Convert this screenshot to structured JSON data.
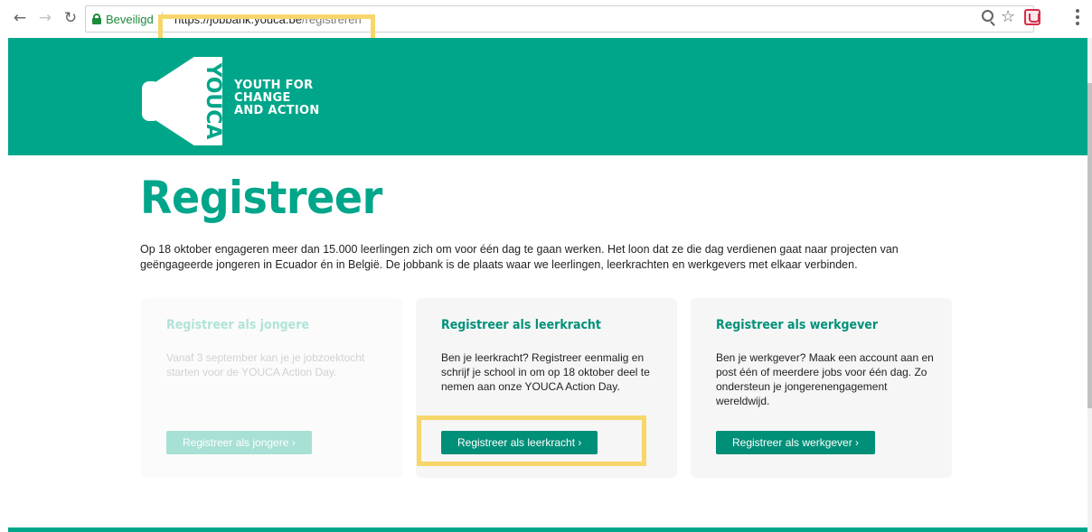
{
  "browser": {
    "secure_label": "Beveiligd",
    "url_host": "https://jobbank.youca.be",
    "url_path": "/registreren"
  },
  "logo": {
    "mark_text": "YOUCA",
    "line1": "YOUTH FOR",
    "line2": "CHANGE",
    "line3": "AND ACTION"
  },
  "main": {
    "title": "Registreer",
    "intro": "Op 18 oktober engageren meer dan 15.000 leerlingen zich om voor één dag te gaan werken. Het loon dat ze die dag verdienen gaat naar projecten van geëngageerde jongeren in Ecuador én in België. De jobbank is de plaats waar we leerlingen, leerkrachten en werkgevers met elkaar verbinden."
  },
  "cards": [
    {
      "title": "Registreer als jongere",
      "text": "Vanaf 3 september kan je je jobzoektocht starten voor de YOUCA Action Day.",
      "button": "Registreer als jongere  ›",
      "state": "disabled"
    },
    {
      "title": "Registreer als leerkracht",
      "text": "Ben je leerkracht? Registreer eenmalig en schrijf je school in om op 18 oktober deel te nemen aan onze YOUCA Action Day.",
      "button": "Registreer als leerkracht  ›",
      "state": "active"
    },
    {
      "title": "Registreer als werkgever",
      "text": "Ben je werkgever? Maak een account aan en post één of meerdere jobs voor één dag. Zo ondersteun je jongerenengagement wereldwijd.",
      "button": "Registreer als werkgever  ›",
      "state": "active"
    }
  ],
  "colors": {
    "brand": "#00a68a",
    "button": "#008f78",
    "highlight": "#f7d66a"
  }
}
